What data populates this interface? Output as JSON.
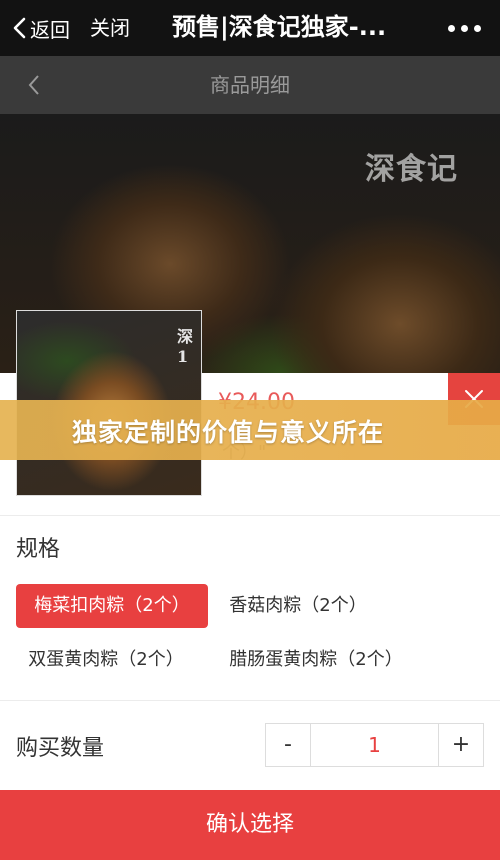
{
  "topbar": {
    "back_label": "返回",
    "close_label": "关闭",
    "title": "预售|深食记独家-..."
  },
  "page": {
    "title": "商品明细",
    "watermark": "深食记",
    "thumb_watermark": "深 1"
  },
  "product": {
    "price": "¥24.00",
    "selected_spec": "个）\""
  },
  "banner": {
    "text": "独家定制的价值与意义所在"
  },
  "spec": {
    "title": "规格",
    "options": [
      {
        "label": "梅菜扣肉粽（2个）",
        "selected": true
      },
      {
        "label": "香菇肉粽（2个）",
        "selected": false
      },
      {
        "label": "双蛋黄肉粽（2个）",
        "selected": false
      },
      {
        "label": "腊肠蛋黄肉粽（2个）",
        "selected": false
      }
    ]
  },
  "quantity": {
    "title": "购买数量",
    "minus": "-",
    "value": "1",
    "plus": "+"
  },
  "confirm_label": "确认选择",
  "colors": {
    "accent": "#e84040",
    "banner": "#e6b050",
    "topbar": "#121212"
  }
}
